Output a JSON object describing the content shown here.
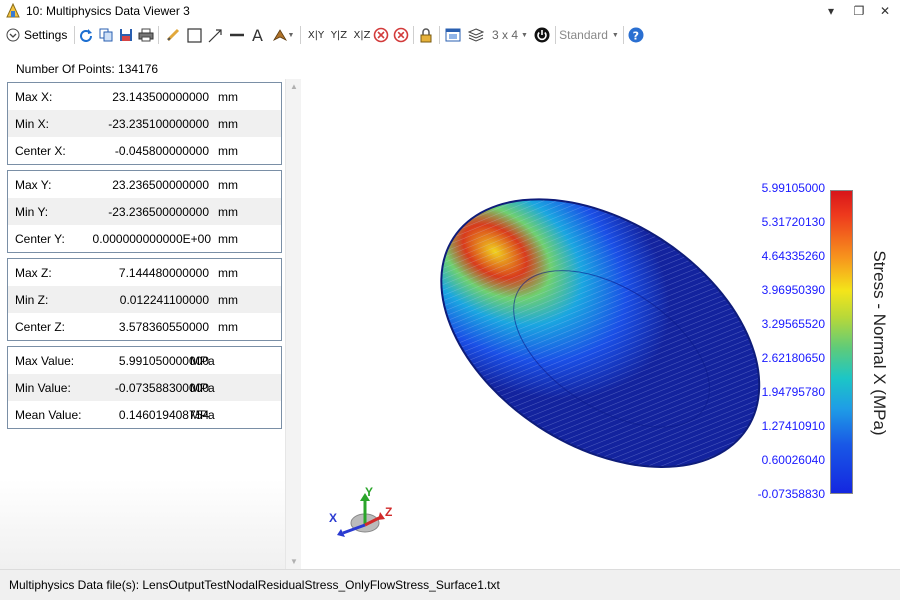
{
  "window": {
    "title": "10: Multiphysics Data Viewer 3",
    "controls": {
      "dropdown": "▾",
      "restore": "❐",
      "close": "✕"
    }
  },
  "toolbar": {
    "settings_label": "Settings",
    "axis_buttons": [
      "X|Y",
      "Y|Z",
      "X|Z"
    ],
    "layout_label": "3 x 4",
    "style_label": "Standard",
    "icons": [
      "settings-chevron-icon",
      "refresh-icon",
      "copy-icon",
      "save-icon",
      "print-icon",
      "pencil-icon",
      "rectangle-icon",
      "arrow-icon",
      "line-icon",
      "text-icon",
      "pointer-icon",
      "rotate-left-icon",
      "rotate-right-icon",
      "lock-icon",
      "window-icon",
      "layers-icon",
      "power-icon",
      "help-icon"
    ]
  },
  "stats": {
    "number_of_points_label": "Number Of Points: 134176",
    "groups": [
      {
        "rows": [
          {
            "label": "Max X:",
            "value": "23.143500000000",
            "unit": "mm"
          },
          {
            "label": "Min X:",
            "value": "-23.235100000000",
            "unit": "mm"
          },
          {
            "label": "Center X:",
            "value": "-0.045800000000",
            "unit": "mm"
          }
        ]
      },
      {
        "rows": [
          {
            "label": "Max Y:",
            "value": "23.236500000000",
            "unit": "mm"
          },
          {
            "label": "Min Y:",
            "value": "-23.236500000000",
            "unit": "mm"
          },
          {
            "label": "Center Y:",
            "value": "0.000000000000E+00",
            "unit": "mm"
          }
        ]
      },
      {
        "rows": [
          {
            "label": "Max Z:",
            "value": "7.144480000000",
            "unit": "mm"
          },
          {
            "label": "Min Z:",
            "value": "0.012241100000",
            "unit": "mm"
          },
          {
            "label": "Center Z:",
            "value": "3.578360550000",
            "unit": "mm"
          }
        ]
      },
      {
        "rows": [
          {
            "label": "Max Value:",
            "value": "5.991050000000",
            "unit": "MPa"
          },
          {
            "label": "Min Value:",
            "value": "-0.073588300000",
            "unit": "MPa"
          },
          {
            "label": "Mean Value:",
            "value": "0.146019408754",
            "unit": "MPa"
          }
        ]
      }
    ]
  },
  "viewer": {
    "colorbar_title": "Stress - Normal X (MPa)",
    "colorbar_ticks": [
      "5.99105000",
      "5.31720130",
      "4.64335260",
      "3.96950390",
      "3.29565520",
      "2.62180650",
      "1.94795780",
      "1.27410910",
      "0.60026040",
      "-0.07358830"
    ],
    "colors": {
      "tick_text": "#1a1aff",
      "high": "#d8151a",
      "low": "#1427e0"
    },
    "triad": {
      "x": "X",
      "y": "Y",
      "z": "Z"
    }
  },
  "status": {
    "text": "Multiphysics Data file(s):  LensOutputTestNodalResidualStress_OnlyFlowStress_Surface1.txt"
  }
}
